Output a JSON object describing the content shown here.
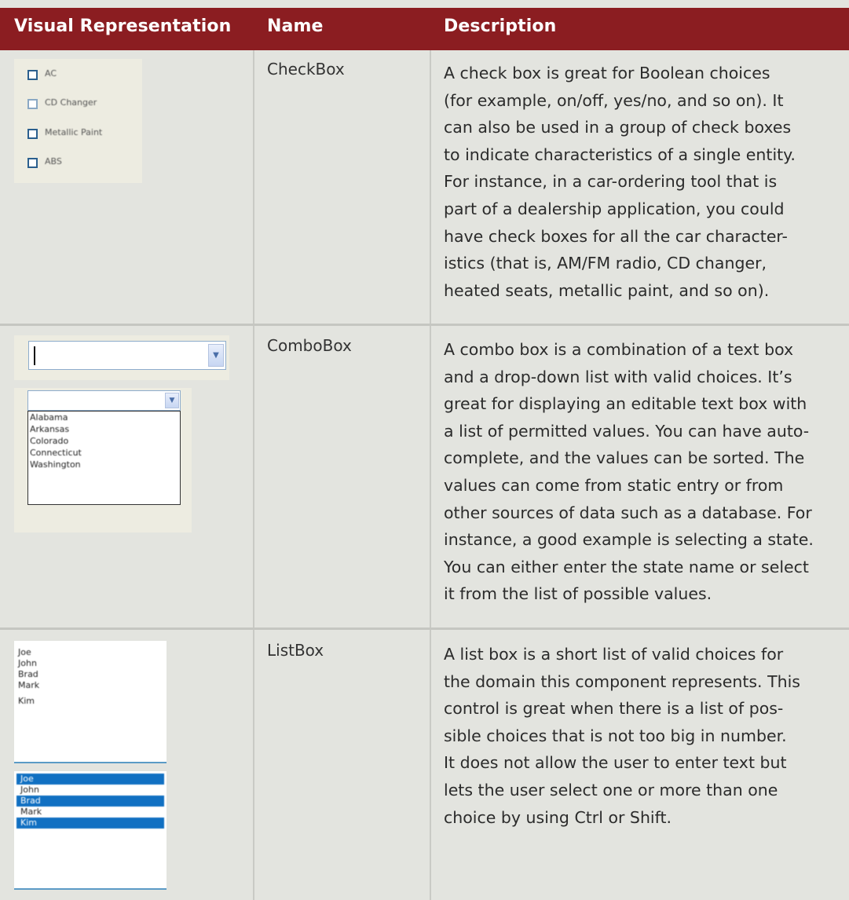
{
  "header": {
    "col1": "Visual Representation",
    "col2": "Name",
    "col3": "Description"
  },
  "rows": [
    {
      "name": "CheckBox",
      "visual": {
        "checkboxes": [
          {
            "label": "AC",
            "checked": false
          },
          {
            "label": "CD Changer",
            "checked": false
          },
          {
            "label": "Metallic Paint",
            "checked": false
          },
          {
            "label": "ABS",
            "checked": false
          }
        ]
      },
      "description_lines": [
        "A check box is great for Boolean choices",
        "(for example, on/off, yes/no, and so on). It",
        "can also be used in a group of check boxes",
        "to indicate characteristics of a single entity.",
        "For instance, in a car-ordering tool that is",
        "part of a dealership application, you could",
        "have check boxes for all the car character-",
        "istics (that is, AM/FM radio, CD changer,",
        "heated seats, metallic paint, and so on)."
      ]
    },
    {
      "name": "ComboBox",
      "visual": {
        "combo_value": "",
        "dropdown_options": [
          "Alabama",
          "Arkansas",
          "Colorado",
          "Connecticut",
          "Washington"
        ],
        "dropdown_icon": "chevron-down-icon"
      },
      "description_lines": [
        "A combo box is a combination of a text box",
        "and a drop-down list with valid choices. It’s",
        "great for displaying an editable text box with",
        "a list of permitted values. You can have auto-",
        "complete, and the values can be sorted. The",
        "values can come from static entry or from",
        "other sources of data such as a database. For",
        "instance, a good example is selecting a state.",
        "You can either enter the state name or select",
        "it from the list of possible values."
      ]
    },
    {
      "name": "ListBox",
      "visual": {
        "list1": [
          "Joe",
          "John",
          "Brad",
          "Mark",
          "Kim"
        ],
        "list2": [
          {
            "label": "Joe",
            "selected": true
          },
          {
            "label": "John",
            "selected": false
          },
          {
            "label": "Brad",
            "selected": true
          },
          {
            "label": "Mark",
            "selected": false
          },
          {
            "label": "Kim",
            "selected": true
          }
        ],
        "selection_color": "#1170c2"
      },
      "description_lines": [
        "A list box is a short list of valid choices for",
        "the domain this component represents. This",
        "control is great when there is a list of pos-",
        "sible choices that is not too big in number.",
        "It does not allow the user to enter text but",
        "lets the user select one or more than one",
        "choice by using Ctrl or Shift."
      ]
    }
  ],
  "colors": {
    "header_bg": "#8b1d21",
    "table_bg": "#e3e4df",
    "visual_panel_bg": "#edece1"
  }
}
